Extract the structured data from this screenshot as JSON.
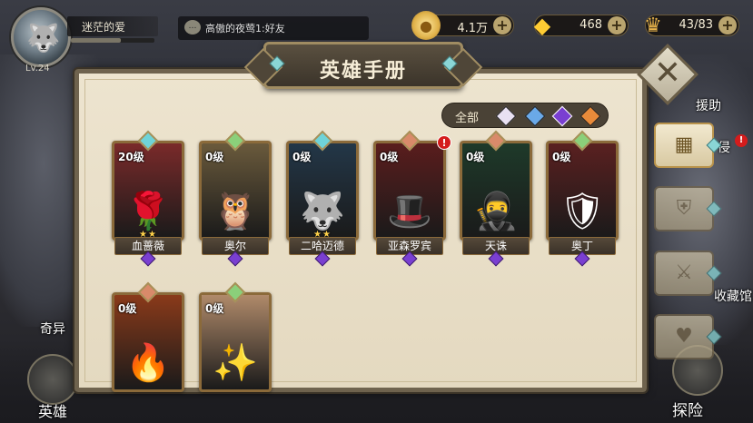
{
  "player": {
    "name": "迷茫的爱",
    "level": "Lv.24",
    "xp_fraction": 0.6
  },
  "chat": {
    "message": "高傲的夜莺1:好友"
  },
  "resources": {
    "gold": "4.1万",
    "gems": "468",
    "stamina": "43/83"
  },
  "side_labels": {
    "assist": "援助",
    "invade": "侵",
    "collection": "收藏馆",
    "strange": "奇异",
    "heroes": "英雄",
    "explore": "探险"
  },
  "panel": {
    "title": "英雄手册",
    "filter_all": "全部"
  },
  "heroes": [
    {
      "level": "20级",
      "stars": "★★",
      "name": "血蔷薇",
      "faction_color": "#6fd3d8",
      "alert": "",
      "art_color": "#7a2a2a",
      "icon": "🌹"
    },
    {
      "level": "0级",
      "stars": "",
      "name": "奥尔",
      "faction_color": "#8bd07a",
      "alert": "",
      "art_color": "#6a5a3c",
      "icon": "🦉"
    },
    {
      "level": "0级",
      "stars": "★★",
      "name": "二哈迈德",
      "faction_color": "#6fd3d8",
      "alert": "",
      "art_color": "#233748",
      "icon": "🐺"
    },
    {
      "level": "0级",
      "stars": "",
      "name": "亚森罗宾",
      "faction_color": "#d98a6a",
      "alert": "!",
      "art_color": "#5a1d1d",
      "icon": "🎩"
    },
    {
      "level": "0级",
      "stars": "",
      "name": "天诛",
      "faction_color": "#d98a6a",
      "alert": "",
      "art_color": "#1e3a2a",
      "icon": "🥷"
    },
    {
      "level": "0级",
      "stars": "",
      "name": "奥丁",
      "faction_color": "#8bd07a",
      "alert": "",
      "art_color": "#5a2020",
      "icon": "🛡"
    },
    {
      "level": "0级",
      "stars": "",
      "name": "",
      "faction_color": "#d98a6a",
      "alert": "",
      "art_color": "#8a3a1a",
      "icon": "🔥"
    },
    {
      "level": "0级",
      "stars": "",
      "name": "",
      "faction_color": "#8bd07a",
      "alert": "",
      "art_color": "#b08a6a",
      "icon": "✨"
    }
  ],
  "icons": {
    "close": "close-icon",
    "gold": "gold-coin-icon",
    "gem": "diamond-icon",
    "stamina": "stamina-icon",
    "chat": "chat-bubble-icon"
  }
}
